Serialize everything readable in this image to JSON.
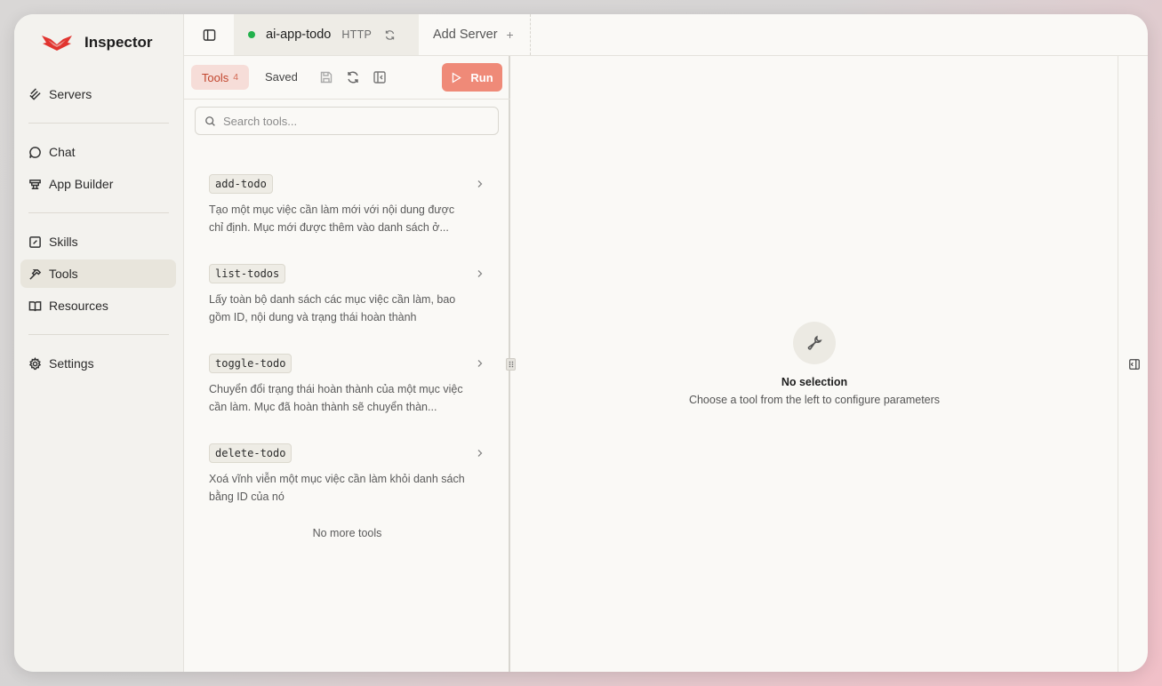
{
  "app": {
    "name": "Inspector",
    "brand_color": "#e1342f"
  },
  "sidebar": {
    "items": [
      {
        "label": "Servers",
        "icon": "servers-icon"
      },
      {
        "label": "Chat",
        "icon": "chat-icon"
      },
      {
        "label": "App Builder",
        "icon": "app-builder-icon"
      },
      {
        "label": "Skills",
        "icon": "skills-icon"
      },
      {
        "label": "Tools",
        "icon": "hammer-icon",
        "active": true
      },
      {
        "label": "Resources",
        "icon": "book-icon"
      },
      {
        "label": "Settings",
        "icon": "gear-icon"
      }
    ]
  },
  "topbar": {
    "server": {
      "name": "ai-app-todo",
      "protocol": "HTTP",
      "status": "connected",
      "status_color": "#23b14d"
    },
    "add_server_label": "Add Server",
    "add_server_plus": "+"
  },
  "tools_panel": {
    "tab_tools": "Tools",
    "tools_count": "4",
    "tab_saved": "Saved",
    "run_label": "Run",
    "run_color": "#ef8a78",
    "search_placeholder": "Search tools...",
    "tools": [
      {
        "name": "add-todo",
        "description": "Tạo một mục việc cần làm mới với nội dung được chỉ định. Mục mới được thêm vào danh sách ở..."
      },
      {
        "name": "list-todos",
        "description": "Lấy toàn bộ danh sách các mục việc cần làm, bao gồm ID, nội dung và trạng thái hoàn thành"
      },
      {
        "name": "toggle-todo",
        "description": "Chuyển đổi trạng thái hoàn thành của một mục việc cần làm. Mục đã hoàn thành sẽ chuyển thàn..."
      },
      {
        "name": "delete-todo",
        "description": "Xoá vĩnh viễn một mục việc cần làm khỏi danh sách bằng ID của nó"
      }
    ],
    "no_more_label": "No more tools"
  },
  "main": {
    "empty_title": "No selection",
    "empty_subtitle": "Choose a tool from the left to configure parameters"
  }
}
